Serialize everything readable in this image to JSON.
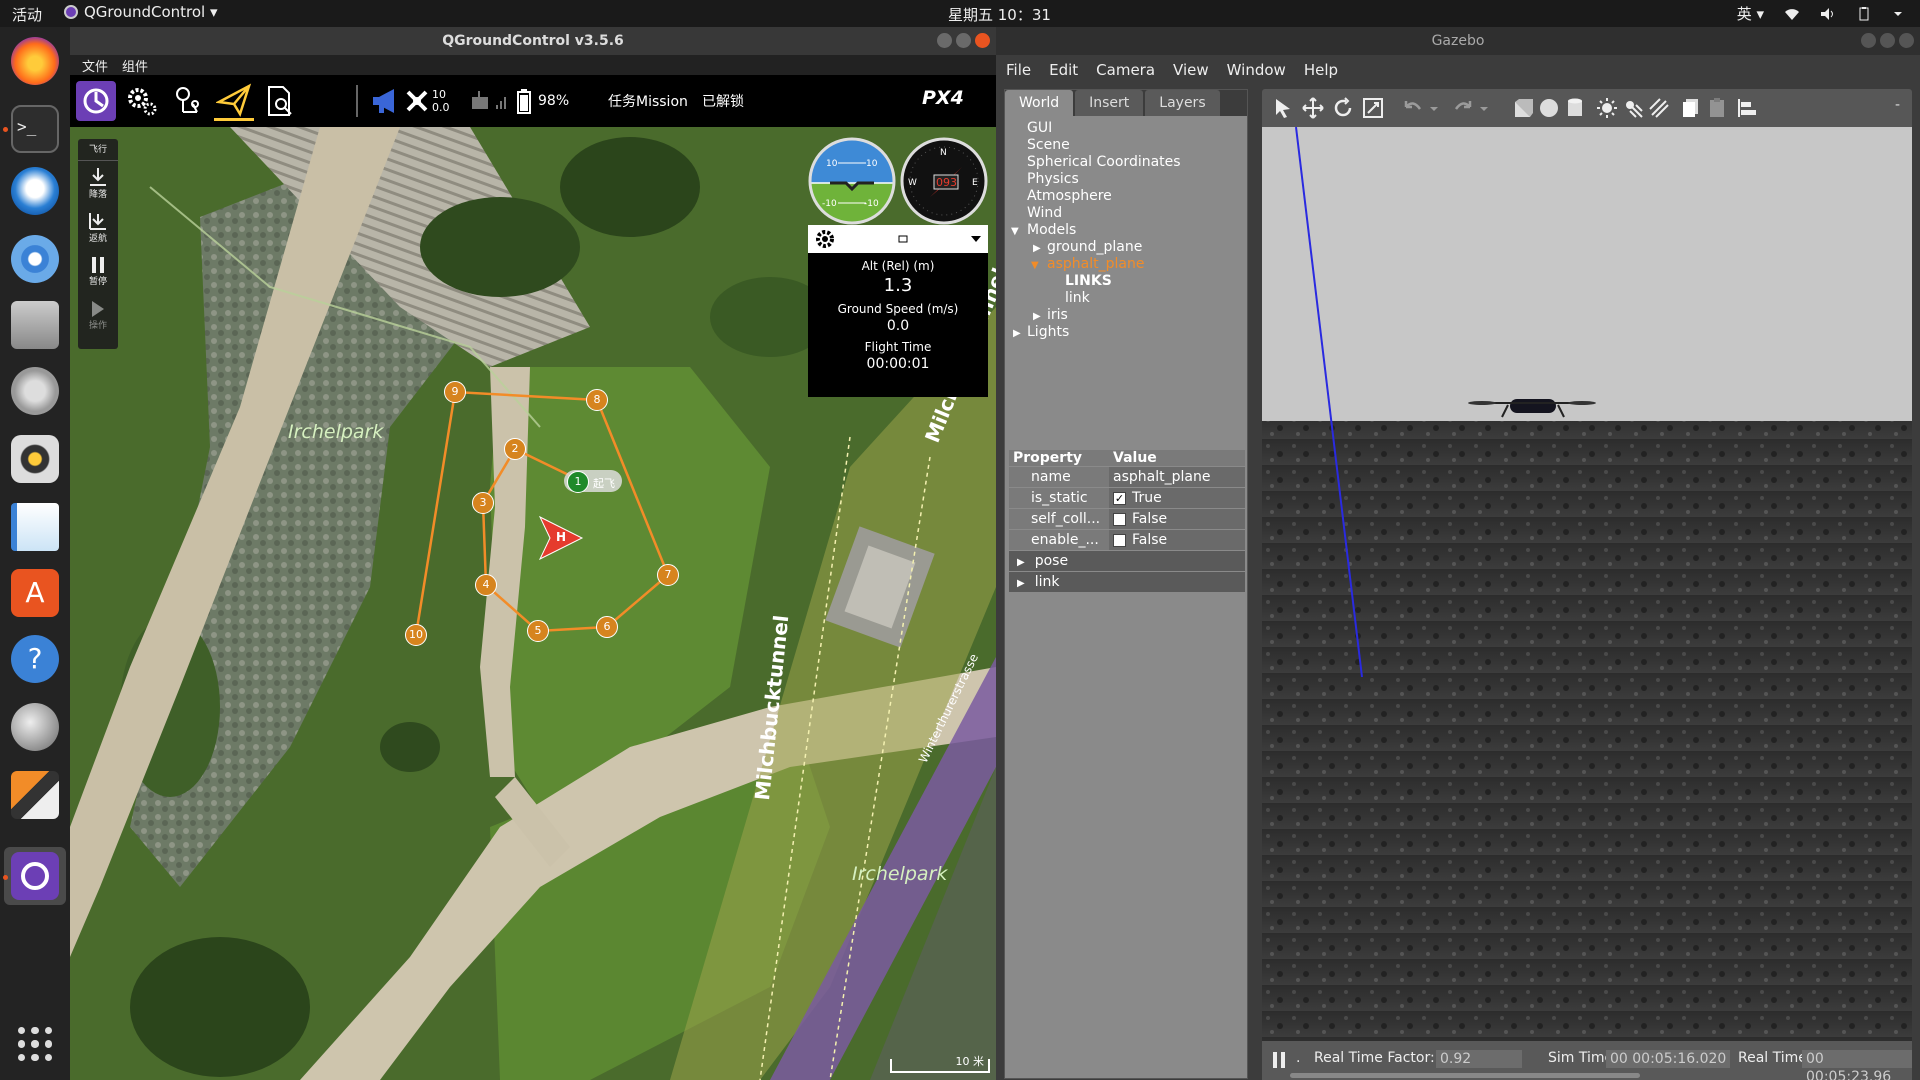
{
  "topbar": {
    "activities": "活动",
    "app_menu": "QGroundControl ▾",
    "clock": "星期五 10：31",
    "ime": "英 ▾"
  },
  "dock": {
    "items": [
      "firefox",
      "terminal",
      "thunderbird",
      "chromium",
      "files",
      "settings",
      "rhythmbox",
      "writer",
      "software-center",
      "help",
      "disk",
      "layers",
      "qgroundcontrol"
    ]
  },
  "qgc": {
    "title": "QGroundControl v3.5.6",
    "menu": [
      "文件",
      "组件"
    ],
    "toolbar": {
      "gps_count": "10",
      "gps_hdop": "0.0",
      "battery": "98%",
      "mode": "任务Mission",
      "arm_state": "已解锁",
      "brand": "PX4"
    },
    "tools": {
      "header": "飞行",
      "land": "降落",
      "rtl": "返航",
      "pause": "暂停",
      "action": "操作"
    },
    "instrument": {
      "heading": "093",
      "compass_n": "N",
      "compass_e": "E",
      "compass_w": "W",
      "pitch_top": "10",
      "pitch_bottom": "-10",
      "alt_label": "Alt (Rel) (m)",
      "alt_value": "1.3",
      "speed_label": "Ground Speed (m/s)",
      "speed_value": "0.0",
      "time_label": "Flight Time",
      "time_value": "00:00:01"
    },
    "map": {
      "park_label_1": "Irchelpark",
      "park_label_2": "Irchelpark",
      "tunnel_label_1": "Milchbucktunnel",
      "tunnel_label_2": "Milchbucktunnel",
      "street_label": "Winterthurerstrasse",
      "scale": "10 米",
      "home": "H",
      "takeoff": "起飞",
      "waypoints": [
        "1",
        "2",
        "3",
        "4",
        "5",
        "6",
        "7",
        "8",
        "9",
        "10"
      ]
    }
  },
  "gazebo": {
    "title": "Gazebo",
    "menu": [
      "File",
      "Edit",
      "Camera",
      "View",
      "Window",
      "Help"
    ],
    "tabs": [
      "World",
      "Insert",
      "Layers"
    ],
    "tree": [
      "GUI",
      "Scene",
      "Spherical Coordinates",
      "Physics",
      "Atmosphere",
      "Wind",
      "Models",
      "ground_plane",
      "asphalt_plane",
      "LINKS",
      "link",
      "iris",
      "Lights"
    ],
    "props": {
      "h_property": "Property",
      "h_value": "Value",
      "name_k": "name",
      "name_v": "asphalt_plane",
      "static_k": "is_static",
      "static_v": "True",
      "coll_k": "self_coll...",
      "coll_v": "False",
      "enable_k": "enable_...",
      "enable_v": "False",
      "pose": "pose",
      "link": "link"
    },
    "status": {
      "rtf_label": "Real Time Factor:",
      "rtf": "0.92",
      "sim_label": "Sim Time:",
      "sim": "00 00:05:16.020",
      "real_label": "Real Time:",
      "real": "00 00:05:23.96"
    }
  }
}
